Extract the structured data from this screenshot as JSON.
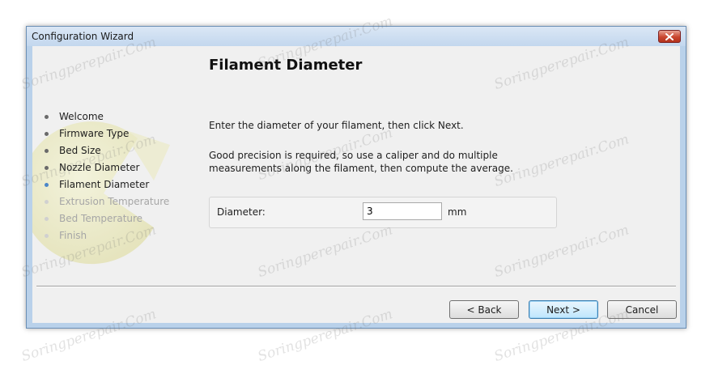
{
  "window": {
    "title": "Configuration Wizard"
  },
  "steps": [
    {
      "label": "Welcome",
      "state": "done"
    },
    {
      "label": "Firmware Type",
      "state": "done"
    },
    {
      "label": "Bed Size",
      "state": "done"
    },
    {
      "label": "Nozzle Diameter",
      "state": "done"
    },
    {
      "label": "Filament Diameter",
      "state": "current"
    },
    {
      "label": "Extrusion Temperature",
      "state": "future"
    },
    {
      "label": "Bed Temperature",
      "state": "future"
    },
    {
      "label": "Finish",
      "state": "future"
    }
  ],
  "page": {
    "heading": "Filament Diameter",
    "instruction": "Enter the diameter of your filament, then click Next.",
    "precision_note": "Good precision is required, so use a caliper and do multiple measurements along the filament, then compute the average."
  },
  "diameter": {
    "label": "Diameter:",
    "value": "3",
    "unit": "mm"
  },
  "buttons": {
    "back": "< Back",
    "next": "Next >",
    "cancel": "Cancel"
  },
  "watermark": {
    "text": "Soringperepair.Com"
  },
  "colors": {
    "window_border": "#b9d1ea",
    "close_button": "#c9462f",
    "dialog_bg": "#f0f0f0",
    "current_step_bullet": "#4a86c8"
  },
  "icons": {
    "close": "close-icon",
    "logo": "slic3r-logo-icon"
  }
}
